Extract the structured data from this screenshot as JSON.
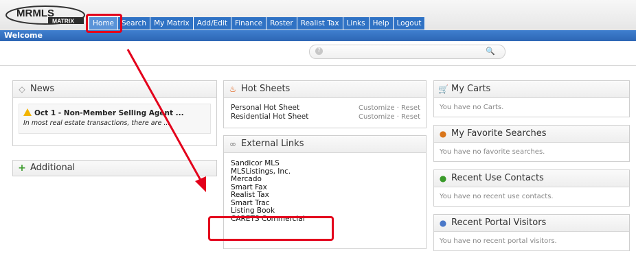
{
  "header": {
    "logo_text": "MRMLS",
    "logo_sub": "MATRIX",
    "tabs": [
      "Home",
      "Search",
      "My Matrix",
      "Add/Edit",
      "Finance",
      "Roster",
      "Realist Tax",
      "Links",
      "Help",
      "Logout"
    ],
    "active_tab": "Home"
  },
  "welcome_bar": {
    "label": "Welcome"
  },
  "search": {
    "placeholder": ""
  },
  "news": {
    "title": "News",
    "item_title": "Oct 1 - Non-Member Selling Agent ...",
    "item_snippet": "In most real estate transactions, there are ..."
  },
  "additional": {
    "title": "Additional"
  },
  "hot_sheets": {
    "title": "Hot Sheets",
    "rows": [
      {
        "name": "Personal Hot Sheet",
        "actions": "Customize · Reset"
      },
      {
        "name": "Residential Hot Sheet",
        "actions": "Customize · Reset"
      }
    ]
  },
  "external_links": {
    "title": "External Links",
    "items": [
      "Sandicor MLS",
      "MLSListings, Inc.",
      "Mercado",
      "Smart Fax",
      "Realist Tax",
      "Smart Trac",
      "Listing Book",
      "CARETS Commercial"
    ]
  },
  "my_carts": {
    "title": "My Carts",
    "empty": "You have no Carts."
  },
  "favorite_searches": {
    "title": "My Favorite Searches",
    "empty": "You have no favorite searches."
  },
  "recent_contacts": {
    "title": "Recent Use Contacts",
    "empty": "You have no recent use contacts."
  },
  "portal_visitors": {
    "title": "Recent Portal Visitors",
    "empty": "You have no recent portal visitors."
  },
  "colors": {
    "nav_blue": "#2f72c4",
    "annotation_red": "#e3001b"
  }
}
